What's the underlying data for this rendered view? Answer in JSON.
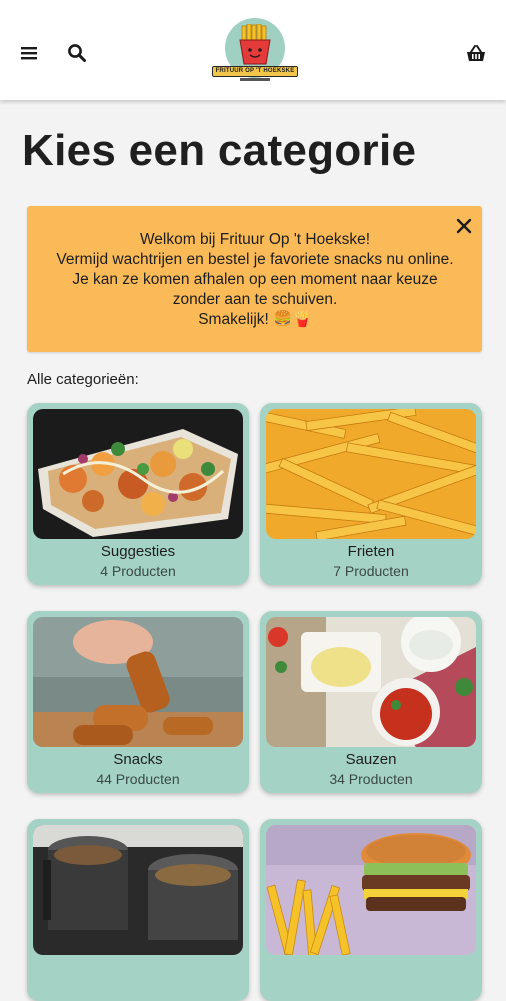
{
  "header": {
    "logo_text": "FRITUUR OP 'T HOEKSKE",
    "icons": [
      "menu-icon",
      "search-icon",
      "basket-icon"
    ]
  },
  "page_title": "Kies een categorie",
  "notice": {
    "lines": [
      "Welkom bij Frituur Op 't Hoekske!",
      "Vermijd wachtrijen en bestel je favoriete snacks nu online.",
      "Je kan ze komen afhalen op een moment naar keuze",
      "zonder aan te schuiven.",
      "Smakelijk! 🍔🍟"
    ],
    "color": "#fbba58"
  },
  "section_label": "Alle categorieën:",
  "categories": [
    {
      "name": "Suggesties",
      "count": "4 Producten"
    },
    {
      "name": "Frieten",
      "count": "7 Producten"
    },
    {
      "name": "Snacks",
      "count": "44 Producten"
    },
    {
      "name": "Sauzen",
      "count": "34 Producten"
    },
    {
      "name": "",
      "count": ""
    },
    {
      "name": "",
      "count": ""
    }
  ],
  "colors": {
    "card": "#a4d2c5",
    "accent": "#9fd0c2"
  }
}
